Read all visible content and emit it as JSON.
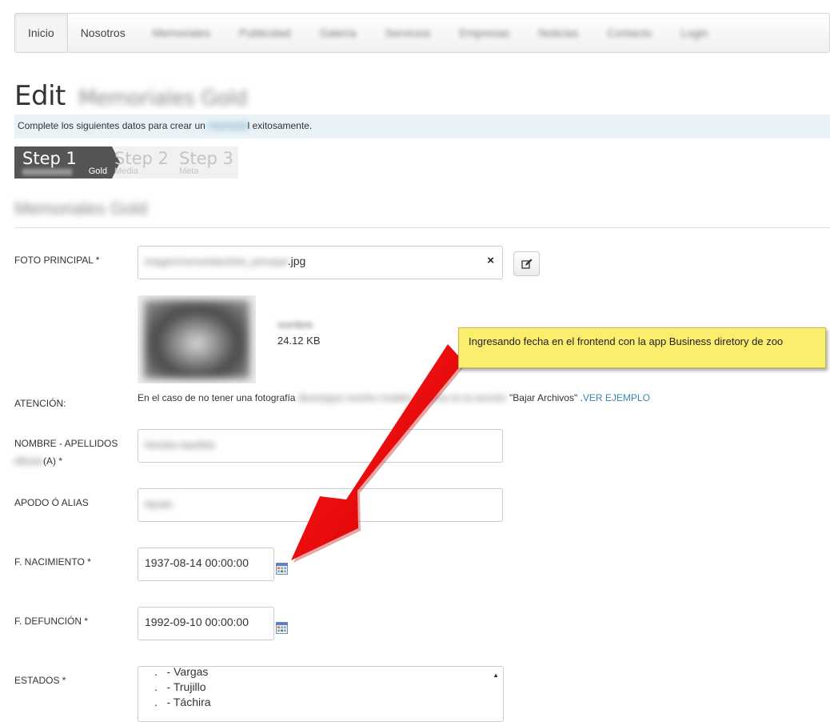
{
  "nav": {
    "items": [
      {
        "label": "Inicio",
        "active": true,
        "blurred": false
      },
      {
        "label": "Nosotros",
        "active": false,
        "blurred": false
      },
      {
        "label": "Memoriales",
        "active": false,
        "blurred": true
      },
      {
        "label": "Publicidad",
        "active": false,
        "blurred": true
      },
      {
        "label": "Galería",
        "active": false,
        "blurred": true
      },
      {
        "label": "Servicios",
        "active": false,
        "blurred": true
      },
      {
        "label": "Empresas",
        "active": false,
        "blurred": true
      },
      {
        "label": "Noticias",
        "active": false,
        "blurred": true
      },
      {
        "label": "Contacto",
        "active": false,
        "blurred": true
      },
      {
        "label": "Login",
        "active": false,
        "blurred": true
      }
    ]
  },
  "page": {
    "title": "Edit",
    "title_blurred": "Memoriales Gold",
    "info_prefix": "Complete los siguientes datos para crear un",
    "info_blurred": "memorial",
    "info_suffix": "l exitosamente."
  },
  "steps": [
    {
      "name": "Step 1",
      "sub": "Gold"
    },
    {
      "name": "Step 2",
      "sub": "Media"
    },
    {
      "name": "Step 3",
      "sub": "Meta"
    }
  ],
  "section_title": "Memoriales Gold",
  "form": {
    "photo": {
      "label": "FOTO PRINCIPAL *",
      "value_blurred": "images/memoriales/foto_principal",
      "value_ext": ".jpg",
      "clear_icon": "×",
      "file_name_blurred": "nombre",
      "file_size": "24.12 KB"
    },
    "attention": {
      "label": "ATENCIÓN:",
      "text_prefix": "En el caso de no tener una fotografía",
      "text_blurred": "descargue nuestro modelo de ficha en la sección",
      "text_suffix": "\"Bajar Archivos\" .",
      "link": "VER EJEMPLO"
    },
    "name": {
      "label": "NOMBRE - APELLIDOS",
      "label_blurred": "difunto",
      "label_suffix": "(A) *",
      "value_blurred": "Nombre Apellido"
    },
    "alias": {
      "label": "APODO Ó ALIAS",
      "value_blurred": "Apodo"
    },
    "birth": {
      "label": "F. NACIMIENTO *",
      "value": "1937-08-14 00:00:00"
    },
    "death": {
      "label": "F. DEFUNCIÓN *",
      "value": "1992-09-10 00:00:00"
    },
    "states": {
      "label": "ESTADOS *",
      "options": [
        ".   - Vargas",
        ".   - Trujillo",
        ".   - Táchira"
      ]
    }
  },
  "annotation": {
    "text": "Ingresando fecha en el frontend con la app Business diretory de zoo",
    "arrow_color": "#f00000"
  }
}
